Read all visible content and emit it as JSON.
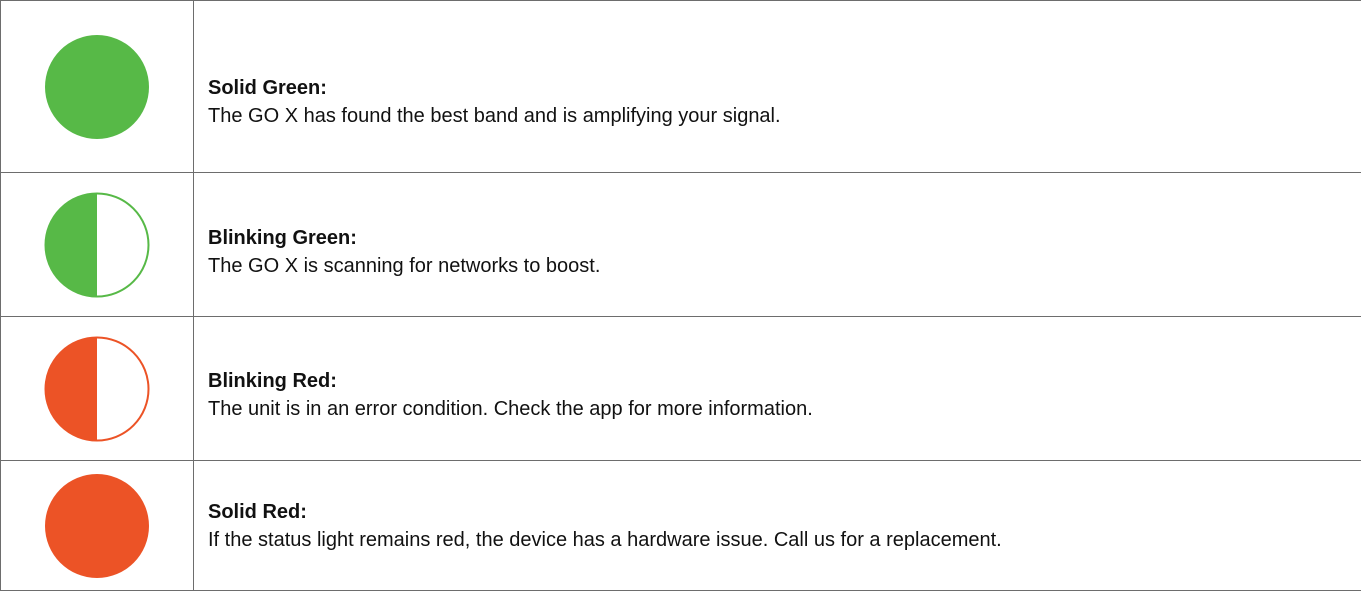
{
  "colors": {
    "green": "#57b947",
    "red": "#ec5326",
    "border": "#6d6d6d",
    "white": "#ffffff"
  },
  "rows": [
    {
      "icon": "solid-green-circle-icon",
      "title": "Solid Green:",
      "description": "The GO X has found the best band and is amplifying your signal."
    },
    {
      "icon": "blinking-green-circle-icon",
      "title": "Blinking Green:",
      "description": "The GO X is scanning for networks to boost."
    },
    {
      "icon": "blinking-red-circle-icon",
      "title": "Blinking Red:",
      "description": "The unit is in an error condition. Check the app for more information."
    },
    {
      "icon": "solid-red-circle-icon",
      "title": "Solid Red:",
      "description": "If the status light remains red, the device has a hardware issue. Call us for a replacement."
    }
  ]
}
